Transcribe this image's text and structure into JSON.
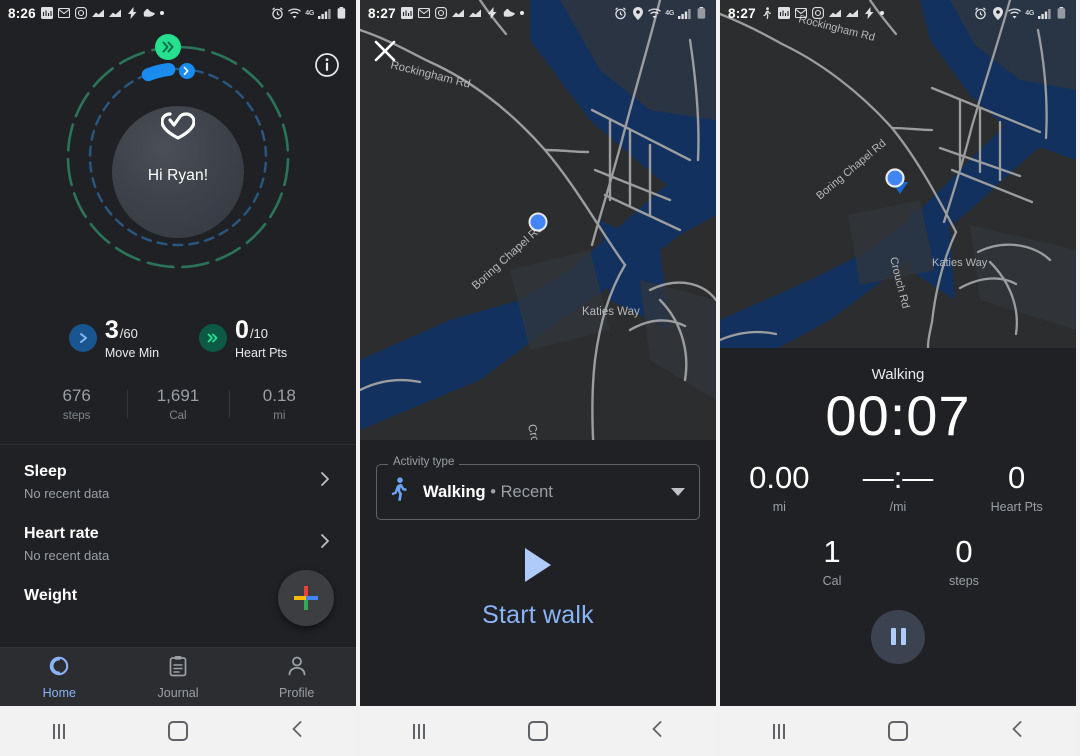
{
  "panels": [
    {
      "status": {
        "time": "8:26",
        "icons": [
          "inv-icon",
          "gmail-icon",
          "instagram-icon",
          "chart-icon",
          "chart-icon",
          "flash-icon",
          "shoe-icon",
          "dot-icon"
        ],
        "right_icons": [
          "alarm-icon",
          "wifi-icon",
          "4g-label",
          "signal-icon",
          "battery-icon"
        ],
        "network": "4G"
      },
      "info_icon": "info-icon",
      "greeting": "Hi Ryan!",
      "goals": [
        {
          "icon": "single-chevron-icon",
          "value": "3",
          "max": "/60",
          "label": "Move Min",
          "color": "#1a73e8"
        },
        {
          "icon": "double-chevron-icon",
          "value": "0",
          "max": "/10",
          "label": "Heart Pts",
          "color": "#24c78e"
        }
      ],
      "metrics": [
        {
          "value": "676",
          "unit": "steps"
        },
        {
          "value": "1,691",
          "unit": "Cal"
        },
        {
          "value": "0.18",
          "unit": "mi"
        }
      ],
      "list": [
        {
          "title": "Sleep",
          "subtitle": "No recent data"
        },
        {
          "title": "Heart rate",
          "subtitle": "No recent data"
        },
        {
          "title": "Weight",
          "subtitle": ""
        }
      ],
      "fab": "add-icon",
      "bottom_nav": [
        {
          "label": "Home",
          "icon": "home-ring-icon",
          "active": true
        },
        {
          "label": "Journal",
          "icon": "clipboard-icon",
          "active": false
        },
        {
          "label": "Profile",
          "icon": "person-icon",
          "active": false
        }
      ]
    },
    {
      "status": {
        "time": "8:27",
        "icons": [
          "inv-icon",
          "gmail-icon",
          "instagram-icon",
          "chart-icon",
          "chart-icon",
          "flash-icon",
          "shoe-icon",
          "dot-icon"
        ],
        "right_icons": [
          "alarm-icon",
          "location-icon",
          "wifi-icon",
          "4g-label",
          "signal-icon",
          "battery-icon"
        ],
        "network": "4G"
      },
      "close_icon": "close-icon",
      "map_labels": [
        "Rockingham Rd",
        "Boring Chapel Rd",
        "Crouch Rd",
        "Katies Way"
      ],
      "activity_field": {
        "legend": "Activity type",
        "icon": "walking-person-icon",
        "value": "Walking",
        "suffix": "• Recent",
        "caret": "chevron-down-icon"
      },
      "start": {
        "icon": "play-icon",
        "label": "Start walk"
      }
    },
    {
      "status": {
        "time": "8:27",
        "icons": [
          "walking-person-icon",
          "inv-icon",
          "gmail-icon",
          "instagram-icon",
          "chart-icon",
          "chart-icon",
          "flash-icon",
          "dot-icon"
        ],
        "right_icons": [
          "alarm-icon",
          "location-icon",
          "wifi-icon",
          "4g-label",
          "signal-icon",
          "battery-icon"
        ],
        "network": "4G"
      },
      "map_labels": [
        "Rockingham Rd",
        "Boring Chapel Rd",
        "Crouch Rd",
        "Katies Way"
      ],
      "tracking": {
        "title": "Walking",
        "timer": "00:07",
        "row1": [
          {
            "value": "0.00",
            "unit": "mi"
          },
          {
            "value": "—:—",
            "unit": "/mi"
          },
          {
            "value": "0",
            "unit": "Heart Pts"
          }
        ],
        "row2": [
          {
            "value": "1",
            "unit": "Cal"
          },
          {
            "value": "0",
            "unit": "steps"
          }
        ],
        "pause_icon": "pause-icon"
      }
    }
  ],
  "android_nav": {
    "recents": "recents-icon",
    "home": "home-icon",
    "back": "back-icon"
  },
  "colors": {
    "accent_blue": "#8ab4f8",
    "green": "#24c78e",
    "move_blue": "#1a73e8",
    "bg": "#202124",
    "water": "#13315f"
  }
}
